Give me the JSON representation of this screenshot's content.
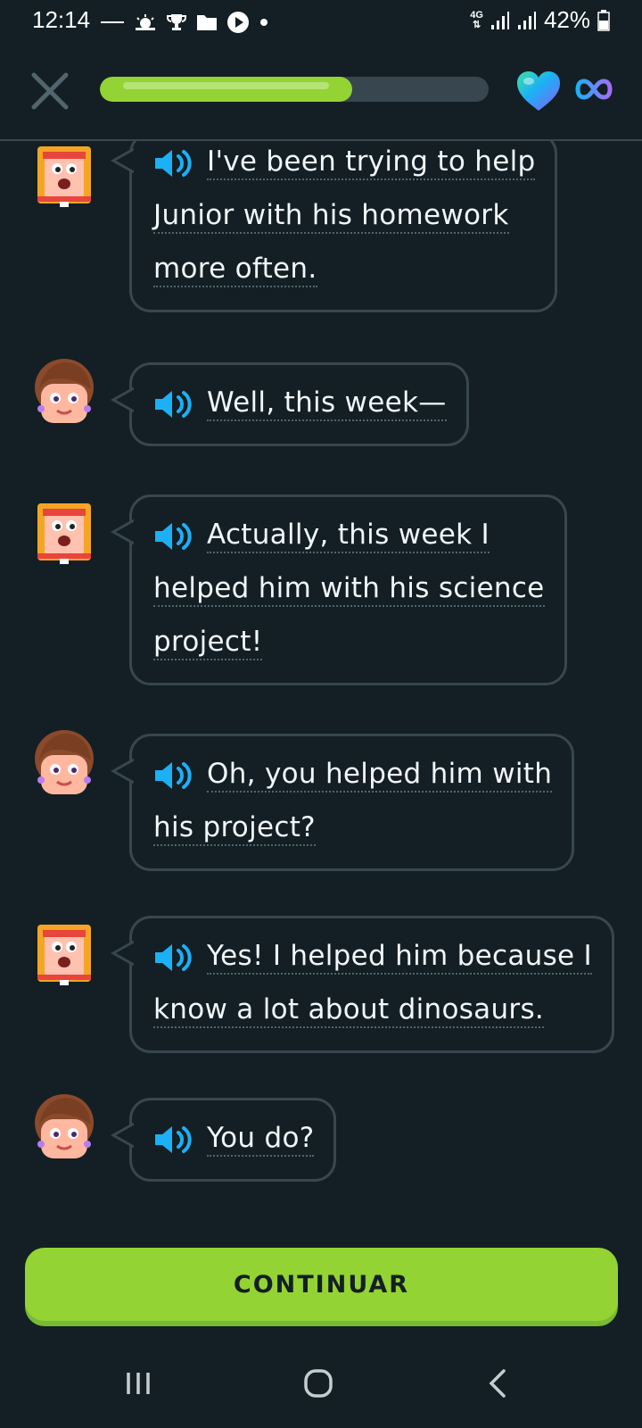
{
  "status_bar": {
    "time": "12:14",
    "network": "4G",
    "battery": "42%",
    "icons": [
      "notification-icon",
      "weather-icon",
      "trophy-icon",
      "folder-icon",
      "play-icon",
      "dot-icon"
    ]
  },
  "header": {
    "close_icon": "close-icon",
    "progress_fraction": 0.65,
    "hearts_icon": "heart-icon",
    "hearts_value": "∞"
  },
  "colors": {
    "background": "#131f24",
    "border": "#37464f",
    "accent_green": "#93d333",
    "speaker_blue": "#1cb0f6",
    "text": "#f1f7fb"
  },
  "messages": [
    {
      "speaker": "junior-woman",
      "lines": [
        "I've been trying to help",
        "Junior with his homework",
        "more often."
      ]
    },
    {
      "speaker": "brown-hair-woman",
      "lines": [
        "Well, this week—"
      ]
    },
    {
      "speaker": "junior-woman",
      "lines": [
        "Actually, this week I",
        "helped him with his science",
        "project!"
      ]
    },
    {
      "speaker": "brown-hair-woman",
      "lines": [
        "Oh, you helped him with",
        "his project?"
      ]
    },
    {
      "speaker": "junior-woman",
      "lines": [
        "Yes! I helped him because I",
        "know a lot about dinosaurs."
      ]
    },
    {
      "speaker": "brown-hair-woman",
      "lines": [
        "You do?"
      ]
    }
  ],
  "continue_button": {
    "label": "CONTINUAR"
  },
  "nav_bar": {
    "items": [
      "recents-icon",
      "home-icon",
      "back-icon"
    ]
  }
}
